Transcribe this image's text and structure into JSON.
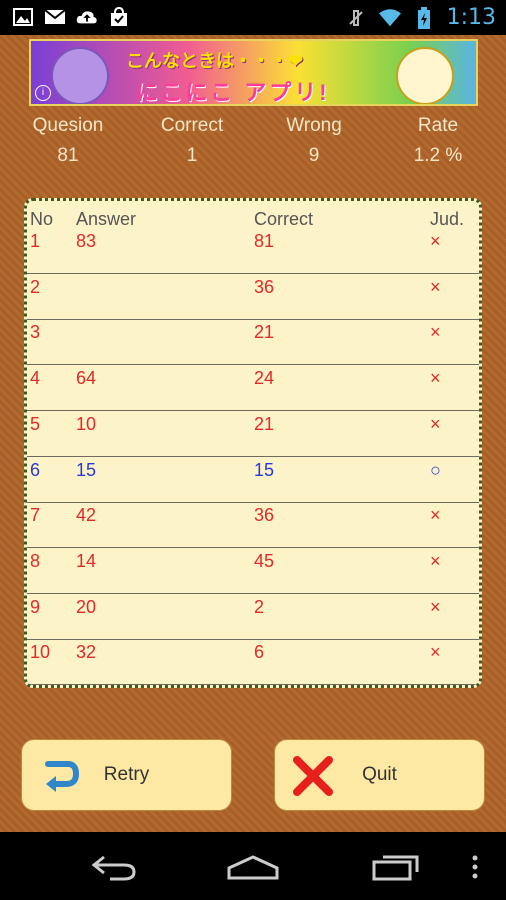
{
  "status": {
    "time": "1:13"
  },
  "banner": {
    "line1": "こんなときは・・・❤",
    "line2": "にこにこ アプリ!",
    "info": "i"
  },
  "stats": [
    {
      "label": "Quesion",
      "value": "81"
    },
    {
      "label": "Correct",
      "value": "1"
    },
    {
      "label": "Wrong",
      "value": "9"
    },
    {
      "label": "Rate",
      "value": "1.2 %"
    }
  ],
  "table": {
    "headers": {
      "no": "No",
      "answer": "Answer",
      "correct": "Correct",
      "judge": "Jud."
    },
    "rows": [
      {
        "no": "1",
        "answer": "83",
        "correct": "81",
        "judge": "×",
        "ok": false
      },
      {
        "no": "2",
        "answer": "",
        "correct": "36",
        "judge": "×",
        "ok": false
      },
      {
        "no": "3",
        "answer": "",
        "correct": "21",
        "judge": "×",
        "ok": false
      },
      {
        "no": "4",
        "answer": "64",
        "correct": "24",
        "judge": "×",
        "ok": false
      },
      {
        "no": "5",
        "answer": "10",
        "correct": "21",
        "judge": "×",
        "ok": false
      },
      {
        "no": "6",
        "answer": "15",
        "correct": "15",
        "judge": "○",
        "ok": true
      },
      {
        "no": "7",
        "answer": "42",
        "correct": "36",
        "judge": "×",
        "ok": false
      },
      {
        "no": "8",
        "answer": "14",
        "correct": "45",
        "judge": "×",
        "ok": false
      },
      {
        "no": "9",
        "answer": "20",
        "correct": "2",
        "judge": "×",
        "ok": false
      },
      {
        "no": "10",
        "answer": "32",
        "correct": "6",
        "judge": "×",
        "ok": false
      }
    ]
  },
  "buttons": {
    "retry": "Retry",
    "quit": "Quit"
  },
  "colors": {
    "wrong": "#e02a2a",
    "right": "#2a3ad6",
    "time": "#56b9e8"
  },
  "icons": {
    "retry": "retry-arrow-icon",
    "quit": "red-x-icon"
  }
}
